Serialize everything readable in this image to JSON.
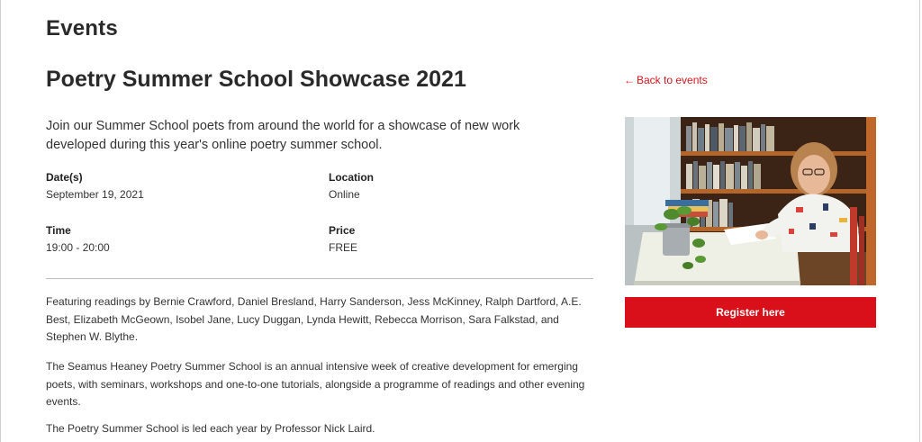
{
  "page": {
    "section_heading": "Events"
  },
  "event": {
    "title": "Poetry Summer School Showcase 2021",
    "intro": "Join our Summer School poets from around the world for a showcase of new work developed during this year's online poetry summer school.",
    "details": {
      "dates_label": "Date(s)",
      "dates_value": "September 19, 2021",
      "location_label": "Location",
      "location_value": "Online",
      "time_label": "Time",
      "time_value": "19:00 - 20:00",
      "price_label": "Price",
      "price_value": "FREE"
    },
    "body": [
      "Featuring readings by Bernie Crawford, Daniel Bresland, Harry Sanderson, Jess McKinney, Ralph Dartford, A.E. Best, Elizabeth McGeown, Isobel Jane, Lucy Duggan, Lynda Hewitt, Rebecca Morrison, Sara Falkstad, and Stephen W. Blythe.",
      "The Seamus Heaney Poetry Summer School is an annual intensive week of creative development for emerging poets, with seminars, workshops and one-to-one tutorials, alongside a programme of readings and other evening events.",
      "The Poetry Summer School is led each year by Professor Nick Laird."
    ]
  },
  "sidebar": {
    "back_arrow": "←",
    "back_label": "Back to events",
    "register_label": "Register here"
  },
  "colors": {
    "accent": "#d9101a",
    "link": "#d2161c",
    "text": "#2a2a2a"
  }
}
